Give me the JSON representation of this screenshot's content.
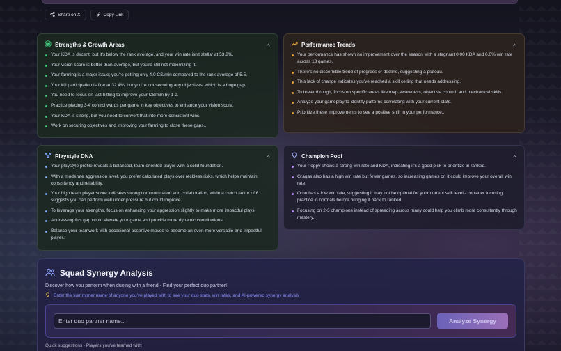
{
  "share": {
    "share_x_label": "Share on X",
    "copy_link_label": "Copy Link"
  },
  "strengths": {
    "title": "Strengths & Growth Areas",
    "items": [
      "Your KDA is decent, but it's below the rank average, and your win rate isn't stellar at 53.8%.",
      "Your vision score is better than average, but you're still not maximizing it.",
      "Your farming is a major issue; you're getting only 4.0 CS/min compared to the rank average of 5.5.",
      "Your kill participation is fine at 32.4%, but you're not securing any objectives, which is a huge gap.",
      "You need to focus on last-hitting to improve your CS/min by 1-2.",
      "Practice placing 3-4 control wards per game in key objectives to enhance your vision score.",
      "Your KDA is strong, but you need to convert that into more consistent wins.",
      "Work on securing objectives and improving your farming to close these gaps.."
    ]
  },
  "performance": {
    "title": "Performance Trends",
    "items": [
      "Your performance has shown no improvement over the season with a stagnant 0.00 KDA and 0.0% win rate across 13 games.",
      "There's no discernible trend of progress or decline, suggesting a plateau.",
      "This lack of change indicates you've reached a skill ceiling that needs addressing.",
      "To break through, focus on specific areas like map awareness, objective control, and mechanical skills.",
      "Analyze your gameplay to identify patterns correlating with your current stats.",
      "Prioritize these improvements to see a positive shift in your performance.."
    ]
  },
  "playstyle": {
    "title": "Playstyle DNA",
    "items": [
      "Your playstyle profile reveals a balanced, team-oriented player with a solid foundation.",
      "With a moderate aggression level, you prefer calculated plays over reckless risks, which helps maintain consistency and reliability.",
      "Your high team player score indicates strong communication and collaboration, while a clutch factor of 6 suggests you can perform well under pressure but could improve.",
      "To leverage your strengths, focus on enhancing your aggression slightly to make more impactful plays.",
      "Addressing this gap could elevate your game and provide more dynamic contributions.",
      "Balance your teamwork with occasional assertive moves to become an even more versatile and impactful player.."
    ]
  },
  "champions": {
    "title": "Champion Pool",
    "items": [
      "Your Poppy shows a strong win rate and KDA, indicating it's a good pick to prioritize in ranked.",
      "Gragas also has a high win rate but fewer games, so increasing games on it could improve your overall win rate.",
      "Ornn has a low win rate, suggesting it may not be optimal for your current skill level - consider focusing practice in normals before bringing it back to ranked.",
      "Focusing on 2-3 champions instead of spreading across many could help you climb more consistently through mastery.."
    ]
  },
  "squad": {
    "title": "Squad Synergy Analysis",
    "subtitle": "Discover how you perform when duoing with a friend - Find your perfect duo partner!",
    "hint": "Enter the summoner name of anyone you've played with to see your duo stats, win rates, and AI-powered synergy analysis",
    "input_placeholder": "Enter duo partner name...",
    "button_label": "Analyze Synergy",
    "quick_label": "Quick suggestions - Players you've teamed with:"
  },
  "colors": {
    "strengths_accent": "#38c172",
    "performance_accent": "#e6a43a",
    "playstyle_accent": "#7aa3f5",
    "champion_accent": "#b88cf5",
    "hint_text": "#8d92ff"
  },
  "icons": {
    "share_x": "share-icon",
    "copy_link": "link-icon",
    "strengths": "target-icon",
    "performance": "trend-up-icon",
    "playstyle": "trophy-icon",
    "champions": "lightbulb-icon",
    "squad": "users-icon",
    "hint": "lightbulb-icon",
    "collapse": "chevron-up-icon"
  }
}
